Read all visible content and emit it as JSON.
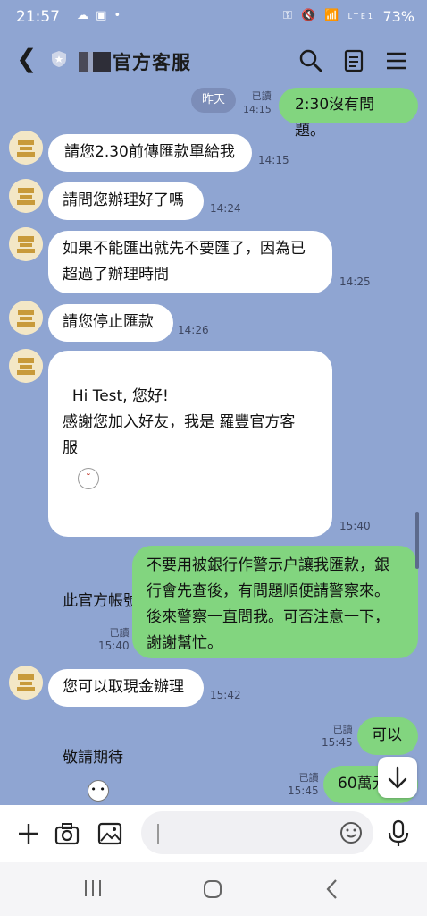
{
  "status": {
    "time": "21:57",
    "battery": "73%",
    "network": "LTE1"
  },
  "header": {
    "title": "官方客服"
  },
  "date_chip": "昨天",
  "messages": [
    {
      "side": "out",
      "text": "2:30沒有問題。",
      "read": "已讀",
      "time": "14:15"
    },
    {
      "side": "in",
      "text": "請您2.30前傳匯款單給我",
      "time": "14:15"
    },
    {
      "side": "in",
      "text": "請問您辦理好了嗎",
      "time": "14:24"
    },
    {
      "side": "in",
      "text": "如果不能匯出就先不要匯了，因為已\n超過了辦理時間",
      "time": "14:25"
    },
    {
      "side": "in",
      "text": "請您停止匯款",
      "time": "14:26"
    },
    {
      "side": "in",
      "text": "Hi Test, 您好!\n感謝您加入好友，我是 羅豐官方客\n服",
      "text2": "此官方帳號將定期發放最新資訊給您",
      "text3": "敬請期待",
      "time": "15:40"
    },
    {
      "side": "out",
      "text": "不要用被銀行作警示户讓我匯款，銀\n行會先查後，有問題順便請警察來。\n後來警察一直問我。可否注意一下，\n謝謝幫忙。",
      "read": "已讀",
      "time": "15:40"
    },
    {
      "side": "in",
      "text": "您可以取現金辦理",
      "time": "15:42"
    },
    {
      "side": "out",
      "text": "可以",
      "read": "已讀",
      "time": "15:45"
    },
    {
      "side": "out",
      "text": "60萬元",
      "read": "已讀",
      "time": "15:45"
    }
  ],
  "icons": {
    "back": "back-arrow-icon",
    "search": "search-icon",
    "notes": "notes-icon",
    "menu": "menu-icon",
    "plus": "plus-icon",
    "camera": "camera-icon",
    "image": "image-icon",
    "emoji": "emoji-icon",
    "mic": "mic-icon",
    "scroll_down": "arrow-down-icon"
  },
  "colors": {
    "background": "#8fa5d2",
    "outgoing": "#82d57f",
    "incoming": "#ffffff"
  }
}
